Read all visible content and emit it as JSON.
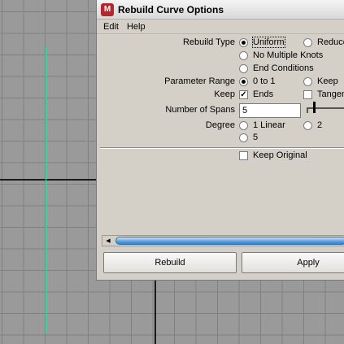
{
  "window": {
    "title": "Rebuild Curve Options",
    "icon": "maya-app-icon"
  },
  "menu": [
    "Edit",
    "Help"
  ],
  "rebuild_type": {
    "label": "Rebuild Type",
    "options": [
      "Uniform",
      "Reduce",
      "No Multiple Knots",
      "End Conditions"
    ],
    "selected": "Uniform"
  },
  "parameter_range": {
    "label": "Parameter Range",
    "options": [
      "0 to 1",
      "Keep"
    ],
    "selected": "0 to 1"
  },
  "keep": {
    "label": "Keep",
    "ends": {
      "label": "Ends",
      "checked": true
    },
    "tangents": {
      "label": "Tangents",
      "checked": false
    }
  },
  "number_of_spans": {
    "label": "Number of Spans",
    "value": "5"
  },
  "degree": {
    "label": "Degree",
    "options": [
      "1 Linear",
      "2",
      "5"
    ],
    "selected": ""
  },
  "keep_original": {
    "label": "Keep Original",
    "checked": false
  },
  "buttons": {
    "rebuild": "Rebuild",
    "apply": "Apply"
  },
  "colors": {
    "curve": "#3fe3a8",
    "scroll_thumb": "#5a9ee0",
    "app_icon": "#b3282c"
  }
}
